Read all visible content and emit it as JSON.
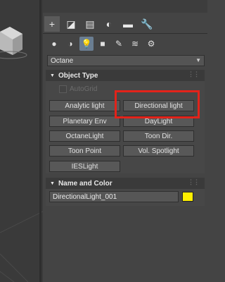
{
  "command_panel": {
    "tabs": [
      {
        "icon": "plus-icon",
        "glyph": "+",
        "active": true
      },
      {
        "icon": "modify-curve-icon",
        "glyph": "◪"
      },
      {
        "icon": "hierarchy-icon",
        "glyph": "▤"
      },
      {
        "icon": "motion-icon",
        "glyph": "◐"
      },
      {
        "icon": "display-monitor-icon",
        "glyph": "▬"
      },
      {
        "icon": "utilities-wrench-icon",
        "glyph": "🔧"
      }
    ],
    "categories": [
      {
        "icon": "geometry-sphere-icon",
        "glyph": "●"
      },
      {
        "icon": "shapes-icon",
        "glyph": "◑"
      },
      {
        "icon": "lights-bulb-icon",
        "glyph": "💡",
        "active": true
      },
      {
        "icon": "camera-icon",
        "glyph": "■"
      },
      {
        "icon": "helpers-ruler-icon",
        "glyph": "✎"
      },
      {
        "icon": "spacewarps-icon",
        "glyph": "≋"
      },
      {
        "icon": "systems-icon",
        "glyph": "⚙"
      }
    ],
    "renderer_dropdown": {
      "value": "Octane"
    },
    "object_type": {
      "title": "Object Type",
      "autogrid_label": "AutoGrid",
      "buttons": [
        "Analytic light",
        "Directional light",
        "Planetary Env",
        "DayLight",
        "OctaneLight",
        "Toon Dir.",
        "Toon Point",
        "Vol. Spotlight",
        "IESLight"
      ]
    },
    "name_and_color": {
      "title": "Name and Color",
      "name_value": "DirectionalLight_001",
      "color": "#ffef00"
    },
    "highlight_color": "#e2231a"
  }
}
